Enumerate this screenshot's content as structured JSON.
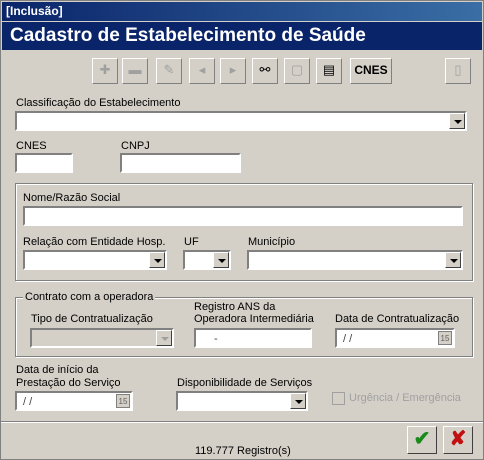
{
  "window": {
    "title": "[Inclusão]"
  },
  "header": {
    "title": "Cadastro de Estabelecimento de Saúde"
  },
  "toolbar": {
    "add_icon": "plus-icon",
    "remove_icon": "minus-icon",
    "edit_icon": "pencil-icon",
    "prev_icon": "previous-icon",
    "next_icon": "next-icon",
    "search_icon": "binoculars-icon",
    "note_icon": "note-icon",
    "report_icon": "report-icon",
    "cnes_label": "CNES",
    "exit_icon": "door-icon"
  },
  "form": {
    "classificacao_label": "Classificação do Estabelecimento",
    "cnes_label": "CNES",
    "cnpj_label": "CNPJ",
    "nome_label": "Nome/Razão Social",
    "relacao_label": "Relação com Entidade Hosp.",
    "uf_label": "UF",
    "municipio_label": "Município",
    "contrato_group_label": "Contrato com a operadora",
    "tipo_contratualizacao_label": "Tipo de Contratualização",
    "registro_ans_label_line1": "Registro ANS da",
    "registro_ans_label_line2": "Operadora Intermediária",
    "registro_ans_value": "-",
    "data_contratualizacao_label": "Data de Contratualização",
    "data_contratualizacao_value": "/ /",
    "data_inicio_label_line1": "Data de início da",
    "data_inicio_label_line2": "Prestação do Serviço",
    "data_inicio_value": "/ /",
    "disponibilidade_label": "Disponibilidade de Serviços",
    "urgencia_label": "Urgência / Emergência"
  },
  "status": {
    "registros": "119.777 Registro(s)"
  },
  "buttons": {
    "confirm_icon": "checkmark-icon",
    "cancel_icon": "x-icon"
  },
  "colors": {
    "header_bg": "#0a246a",
    "confirm": "#1a8a1a",
    "cancel": "#c01010"
  }
}
